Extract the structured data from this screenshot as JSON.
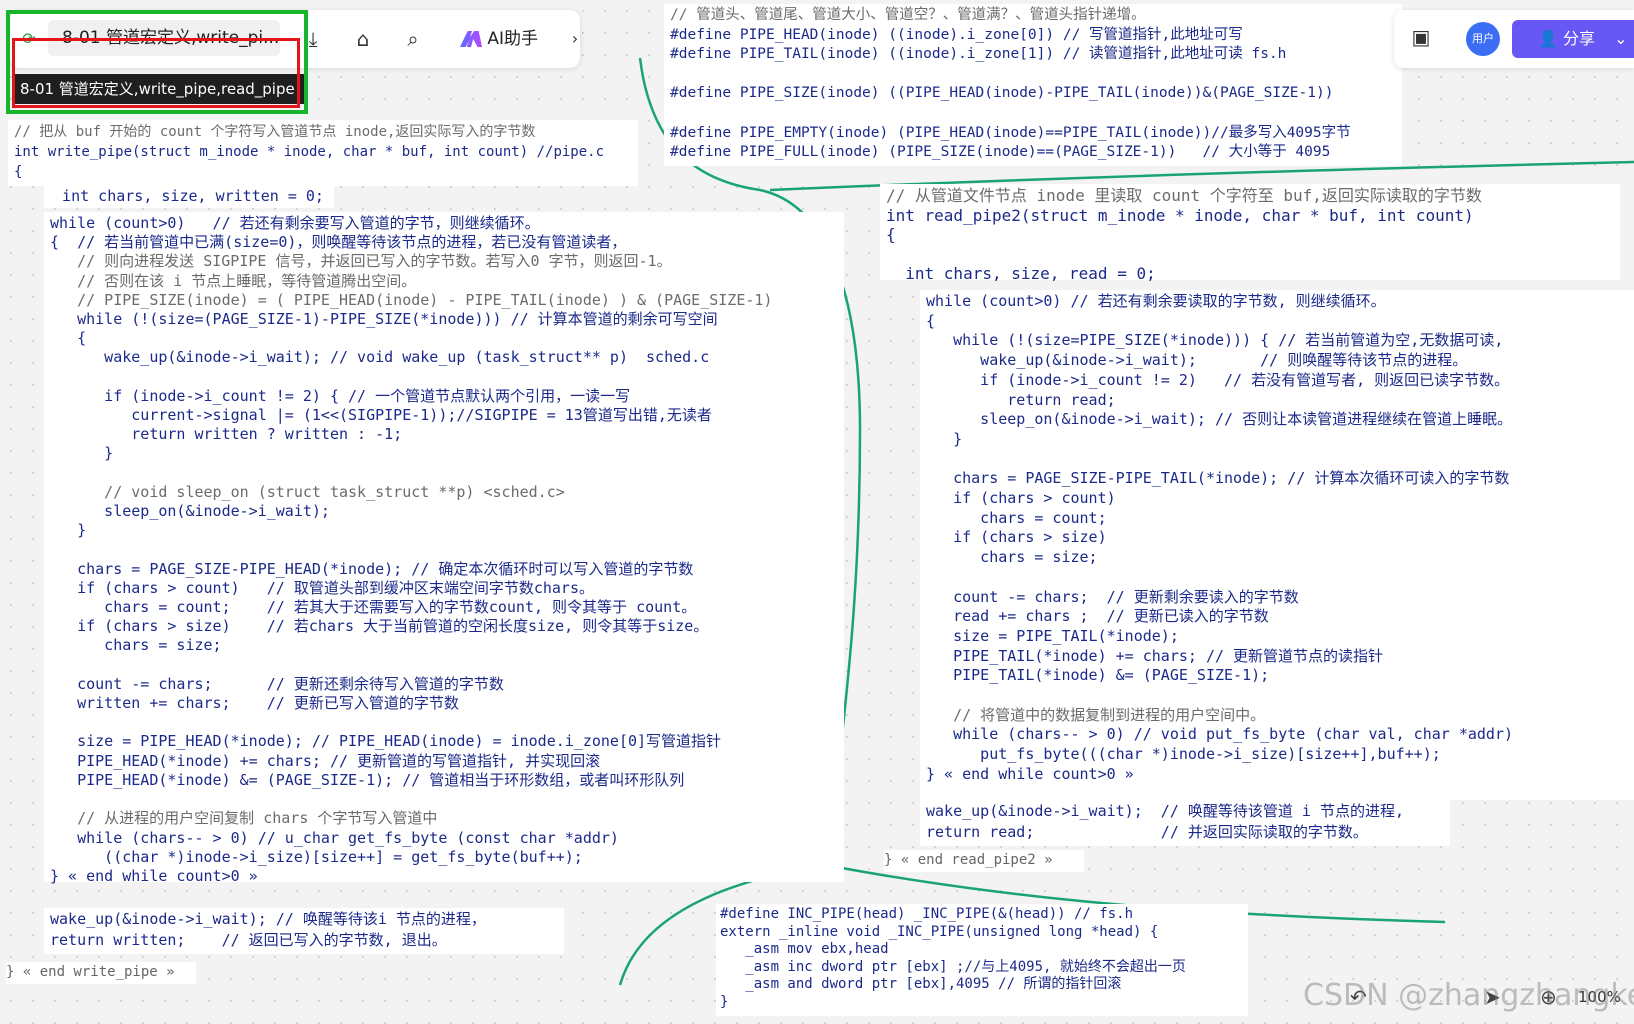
{
  "toolbar": {
    "doc_title": "8-01 管道宏定义,write_pi...",
    "ai_label": "AI助手",
    "tooltip": "8-01  管道宏定义,write_pipe,read_pipe",
    "icons": [
      "sync-icon",
      "import-icon",
      "tag-icon",
      "search-icon",
      "ai-logo-icon",
      "chevron-right-icon"
    ]
  },
  "top_right": {
    "avatar_text": "用户",
    "share_label": "分享",
    "icons": [
      "briefcase-icon",
      "user-share-icon",
      "chevron-down-icon"
    ]
  },
  "bottom_right": {
    "zoom": "100%",
    "icons": [
      "undo-icon",
      "pointer-icon",
      "zoom-icon"
    ]
  },
  "watermark": "CSDN @zhangzhangkeji",
  "accent_color": "#6757f5",
  "connector_color": "#1aa37a",
  "panels": {
    "macros": [
      "// 管道头、管道尾、管道大小、管道空？、管道满？、管道头指针递增。",
      "#define PIPE_HEAD(inode) ((inode).i_zone[0]) // 写管道指针,此地址可写",
      "#define PIPE_TAIL(inode) ((inode).i_zone[1]) // 读管道指针,此地址可读 fs.h",
      "",
      "#define PIPE_SIZE(inode) ((PIPE_HEAD(inode)-PIPE_TAIL(inode))&(PAGE_SIZE-1))",
      "",
      "#define PIPE_EMPTY(inode) (PIPE_HEAD(inode)==PIPE_TAIL(inode))//最多写入4095字节",
      "#define PIPE_FULL(inode) (PIPE_SIZE(inode)==(PAGE_SIZE-1))   // 大小等于 4095"
    ],
    "write_header": [
      "// 把从 buf 开始的 count 个字符写入管道节点 inode,返回实际写入的字节数",
      "int write_pipe(struct m_inode * inode, char * buf, int count) //pipe.c",
      "{"
    ],
    "write_decl": "  int chars, size, written = 0;",
    "write_body": [
      "while (count>0)   // 若还有剩余要写入管道的字节，则继续循环。",
      "{  // 若当前管道中已满(size=0)，则唤醒等待该节点的进程，若已没有管道读者，",
      "   // 则向进程发送 SIGPIPE 信号，并返回已写入的字节数。若写入0 字节，则返回-1。",
      "   // 否则在该 i 节点上睡眠，等待管道腾出空间。",
      "   // PIPE_SIZE(inode) = ( PIPE_HEAD(inode) - PIPE_TAIL(inode) ) & (PAGE_SIZE-1)",
      "   while (!(size=(PAGE_SIZE-1)-PIPE_SIZE(*inode))) // 计算本管道的剩余可写空间",
      "   {",
      "      wake_up(&inode->i_wait); // void wake_up (task_struct** p)  sched.c",
      "",
      "      if (inode->i_count != 2) { // 一个管道节点默认两个引用，一读一写",
      "         current->signal |= (1<<(SIGPIPE-1));//SIGPIPE = 13管道写出错,无读者",
      "         return written ? written : -1;",
      "      }",
      "",
      "      // void sleep_on (struct task_struct **p) <sched.c>",
      "      sleep_on(&inode->i_wait);",
      "   }",
      "",
      "   chars = PAGE_SIZE-PIPE_HEAD(*inode); // 确定本次循环时可以写入管道的字节数",
      "   if (chars > count)   // 取管道头部到缓冲区末端空间字节数chars。",
      "      chars = count;    // 若其大于还需要写入的字节数count, 则令其等于 count。",
      "   if (chars > size)    // 若chars 大于当前管道的空闲长度size, 则令其等于size。",
      "      chars = size;",
      "",
      "   count -= chars;      // 更新还剩余待写入管道的字节数",
      "   written += chars;    // 更新已写入管道的字节数",
      "",
      "   size = PIPE_HEAD(*inode); // PIPE_HEAD(inode) = inode.i_zone[0]写管道指针",
      "   PIPE_HEAD(*inode) += chars; // 更新管道的写管道指针, 并实现回滚",
      "   PIPE_HEAD(*inode) &= (PAGE_SIZE-1); // 管道相当于环形数组，或者叫环形队列",
      "",
      "   // 从进程的用户空间复制 chars 个字节写入管道中",
      "   while (chars-- > 0) // u_char get_fs_byte (const char *addr)",
      "      ((char *)inode->i_size)[size++] = get_fs_byte(buf++);",
      "} « end while count>0 »"
    ],
    "write_tail": [
      "wake_up(&inode->i_wait); // 唤醒等待该i 节点的进程，",
      "return written;    // 返回已写入的字节数, 退出。"
    ],
    "write_end": "} « end write_pipe »",
    "read_header": [
      "// 从管道文件节点 inode 里读取 count 个字符至 buf,返回实际读取的字节数",
      "int read_pipe2(struct m_inode * inode, char * buf, int count)",
      "{",
      "",
      "  int chars, size, read = 0;"
    ],
    "read_body": [
      "while (count>0) // 若还有剩余要读取的字节数, 则继续循环。",
      "{",
      "   while (!(size=PIPE_SIZE(*inode))) { // 若当前管道为空,无数据可读,",
      "      wake_up(&inode->i_wait);       // 则唤醒等待该节点的进程。",
      "      if (inode->i_count != 2)   // 若没有管道写者, 则返回已读字节数。",
      "         return read;",
      "      sleep_on(&inode->i_wait); // 否则让本读管道进程继续在管道上睡眠。",
      "   }",
      "",
      "   chars = PAGE_SIZE-PIPE_TAIL(*inode); // 计算本次循环可读入的字节数",
      "   if (chars > count)",
      "      chars = count;",
      "   if (chars > size)",
      "      chars = size;",
      "",
      "   count -= chars;  // 更新剩余要读入的字节数",
      "   read += chars ;  // 更新已读入的字节数",
      "   size = PIPE_TAIL(*inode);",
      "   PIPE_TAIL(*inode) += chars; // 更新管道节点的读指针",
      "   PIPE_TAIL(*inode) &= (PAGE_SIZE-1);",
      "",
      "   // 将管道中的数据复制到进程的用户空间中。",
      "   while (chars-- > 0) // void put_fs_byte (char val, char *addr)",
      "      put_fs_byte(((char *)inode->i_size)[size++],buf++);",
      "} « end while count>0 »"
    ],
    "read_tail": [
      "wake_up(&inode->i_wait);  // 唤醒等待该管道 i 节点的进程,",
      "return read;              // 并返回实际读取的字节数。"
    ],
    "read_end": "} « end read_pipe2 »",
    "inc_pipe": [
      "#define INC_PIPE(head) _INC_PIPE(&(head)) // fs.h",
      "extern _inline void _INC_PIPE(unsigned long *head) {",
      "   _asm mov ebx,head",
      "   _asm inc dword ptr [ebx] ;//与上4095, 就始终不会超出一页",
      "   _asm and dword ptr [ebx],4095 // 所谓的指针回滚",
      "}"
    ]
  }
}
